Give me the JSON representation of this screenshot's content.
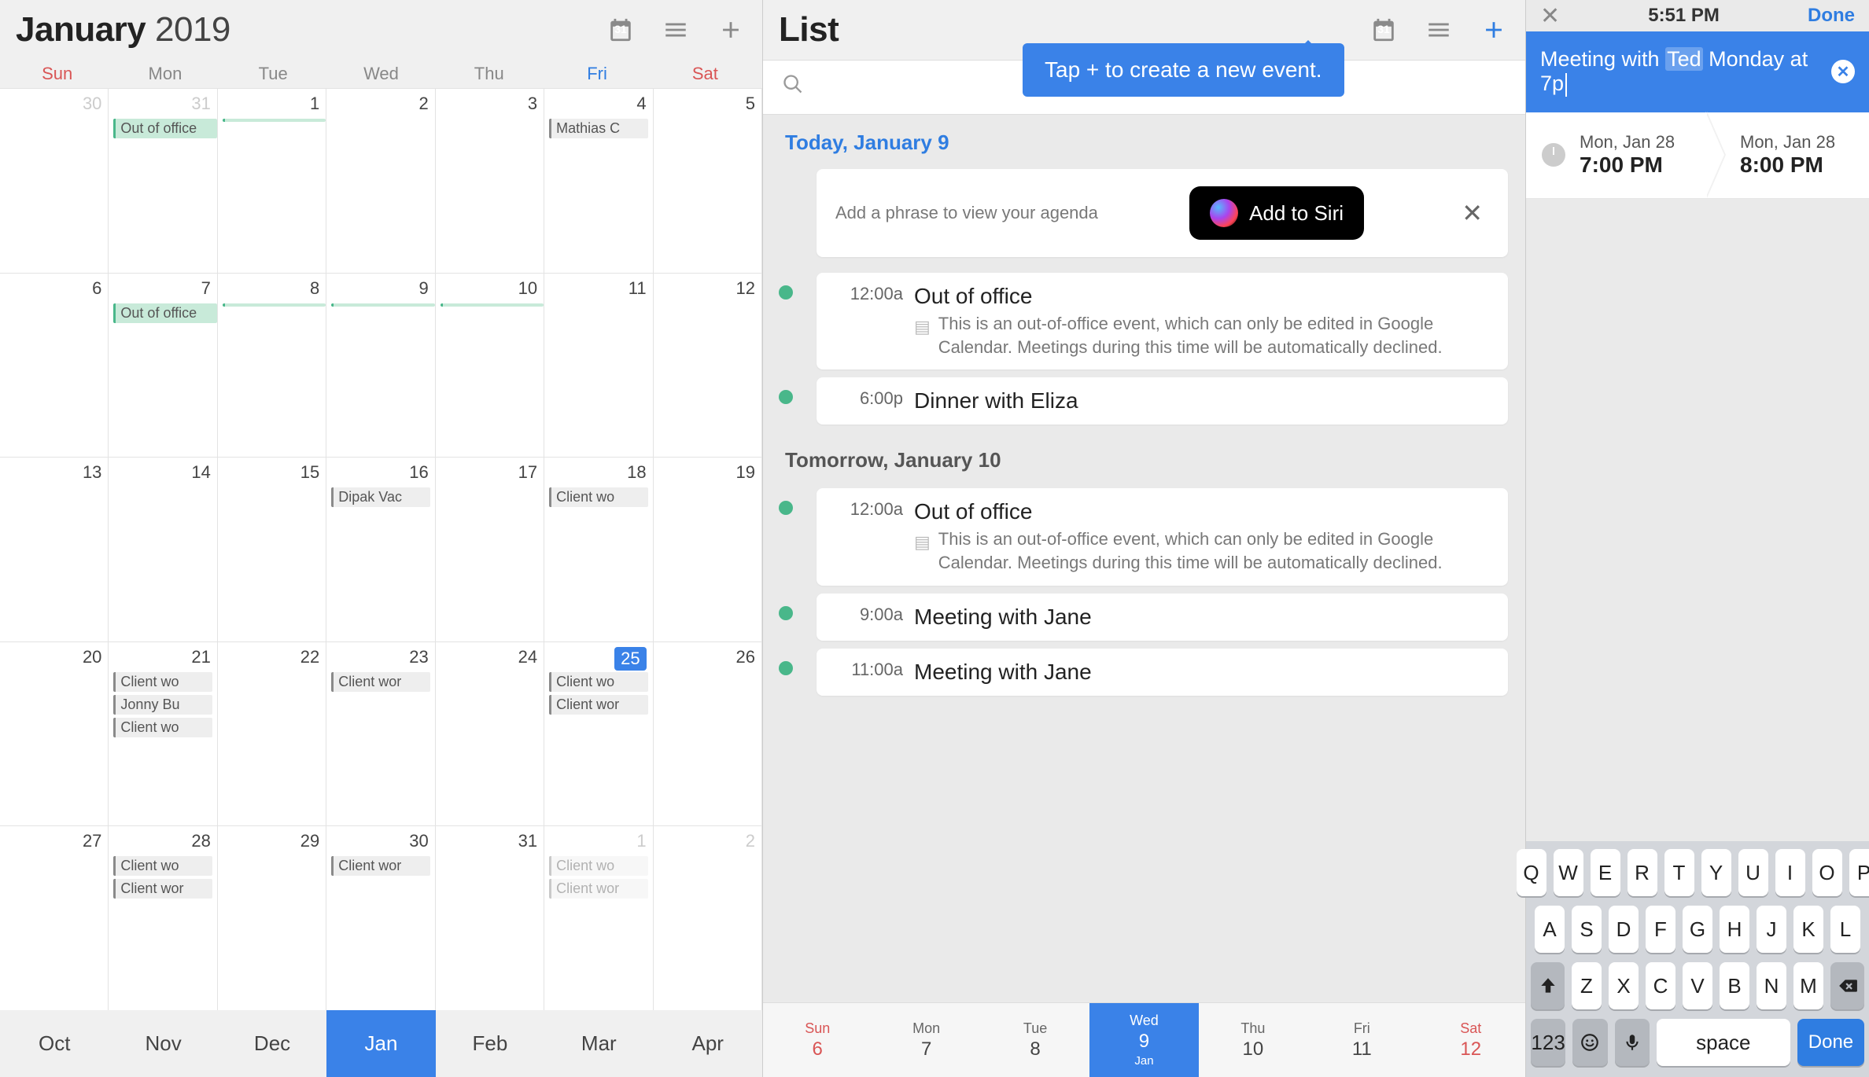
{
  "pane1": {
    "month": "January",
    "year": "2019",
    "cal_icon_day": "31",
    "dow": [
      "Sun",
      "Mon",
      "Tue",
      "Wed",
      "Thu",
      "Fri",
      "Sat"
    ],
    "weeks": [
      [
        {
          "n": "30",
          "out": true
        },
        {
          "n": "31",
          "out": true,
          "chips": [
            {
              "t": "Out of office",
              "c": "green",
              "span": true
            }
          ]
        },
        {
          "n": "1",
          "chips": [
            {
              "t": "",
              "c": "green",
              "span": true
            }
          ]
        },
        {
          "n": "2"
        },
        {
          "n": "3"
        },
        {
          "n": "4",
          "chips": [
            {
              "t": "Mathias C"
            }
          ]
        },
        {
          "n": "5"
        }
      ],
      [
        {
          "n": "6"
        },
        {
          "n": "7",
          "chips": [
            {
              "t": "Out of office",
              "c": "green",
              "span": true
            }
          ]
        },
        {
          "n": "8",
          "chips": [
            {
              "t": "",
              "c": "green",
              "span": true
            }
          ]
        },
        {
          "n": "9",
          "chips": [
            {
              "t": "",
              "c": "green",
              "span": true
            }
          ]
        },
        {
          "n": "10",
          "chips": [
            {
              "t": "",
              "c": "green",
              "span": true
            }
          ]
        },
        {
          "n": "11"
        },
        {
          "n": "12"
        }
      ],
      [
        {
          "n": "13"
        },
        {
          "n": "14"
        },
        {
          "n": "15"
        },
        {
          "n": "16",
          "chips": [
            {
              "t": "Dipak Vac"
            }
          ]
        },
        {
          "n": "17"
        },
        {
          "n": "18",
          "chips": [
            {
              "t": "Client wo"
            }
          ]
        },
        {
          "n": "19"
        }
      ],
      [
        {
          "n": "20"
        },
        {
          "n": "21",
          "chips": [
            {
              "t": "Client wo"
            },
            {
              "t": "Jonny Bu"
            },
            {
              "t": "Client wo"
            }
          ]
        },
        {
          "n": "22"
        },
        {
          "n": "23",
          "chips": [
            {
              "t": "Client wor"
            }
          ]
        },
        {
          "n": "24"
        },
        {
          "n": "25",
          "today": true,
          "chips": [
            {
              "t": "Client wo"
            },
            {
              "t": "Client wor"
            }
          ]
        },
        {
          "n": "26"
        }
      ],
      [
        {
          "n": "27"
        },
        {
          "n": "28",
          "chips": [
            {
              "t": "Client wo"
            },
            {
              "t": "Client wor"
            }
          ]
        },
        {
          "n": "29"
        },
        {
          "n": "30",
          "chips": [
            {
              "t": "Client wor"
            }
          ]
        },
        {
          "n": "31"
        },
        {
          "n": "1",
          "out": true,
          "chips": [
            {
              "t": "Client wo",
              "dim": true
            },
            {
              "t": "Client wor",
              "dim": true
            }
          ]
        },
        {
          "n": "2",
          "out": true
        }
      ]
    ],
    "months": [
      "Oct",
      "Nov",
      "Dec",
      "Jan",
      "Feb",
      "Mar",
      "Apr"
    ],
    "month_sel": "Jan"
  },
  "pane2": {
    "title": "List",
    "cal_icon_day": "31",
    "tooltip": "Tap + to create a new event.",
    "today_label": "Today, January 9",
    "siri_hint": "Add a phrase to view your agenda",
    "siri_btn": "Add to Siri",
    "tomorrow_label": "Tomorrow, January 10",
    "events_today": [
      {
        "time": "12:00a",
        "title": "Out of office",
        "desc": "This is an out-of-office event, which can only be edited in Google Calendar. Meetings during this time will be automatically declined."
      },
      {
        "time": "6:00p",
        "title": "Dinner with Eliza"
      }
    ],
    "events_tomorrow": [
      {
        "time": "12:00a",
        "title": "Out of office",
        "desc": "This is an out-of-office event, which can only be edited in Google Calendar. Meetings during this time will be automatically declined."
      },
      {
        "time": "9:00a",
        "title": "Meeting with Jane"
      },
      {
        "time": "11:00a",
        "title": "Meeting with Jane"
      }
    ],
    "week": [
      {
        "dw": "Sun",
        "dn": "6",
        "wknd": true
      },
      {
        "dw": "Mon",
        "dn": "7"
      },
      {
        "dw": "Tue",
        "dn": "8"
      },
      {
        "dw": "Wed",
        "dn": "9",
        "mo": "Jan",
        "sel": true
      },
      {
        "dw": "Thu",
        "dn": "10"
      },
      {
        "dw": "Fri",
        "dn": "11"
      },
      {
        "dw": "Sat",
        "dn": "12",
        "wknd": true
      }
    ]
  },
  "pane3": {
    "time": "5:51 PM",
    "done": "Done",
    "input_prefix": "Meeting with ",
    "input_hl": "Ted",
    "input_suffix": " Monday at 7p",
    "start_date": "Mon, Jan 28",
    "start_time": "7:00 PM",
    "end_date": "Mon, Jan 28",
    "end_time": "8:00 PM",
    "kbd_r1": [
      "Q",
      "W",
      "E",
      "R",
      "T",
      "Y",
      "U",
      "I",
      "O",
      "P"
    ],
    "kbd_r2": [
      "A",
      "S",
      "D",
      "F",
      "G",
      "H",
      "J",
      "K",
      "L"
    ],
    "kbd_r3": [
      "Z",
      "X",
      "C",
      "V",
      "B",
      "N",
      "M"
    ],
    "key_123": "123",
    "key_space": "space",
    "key_done": "Done"
  }
}
